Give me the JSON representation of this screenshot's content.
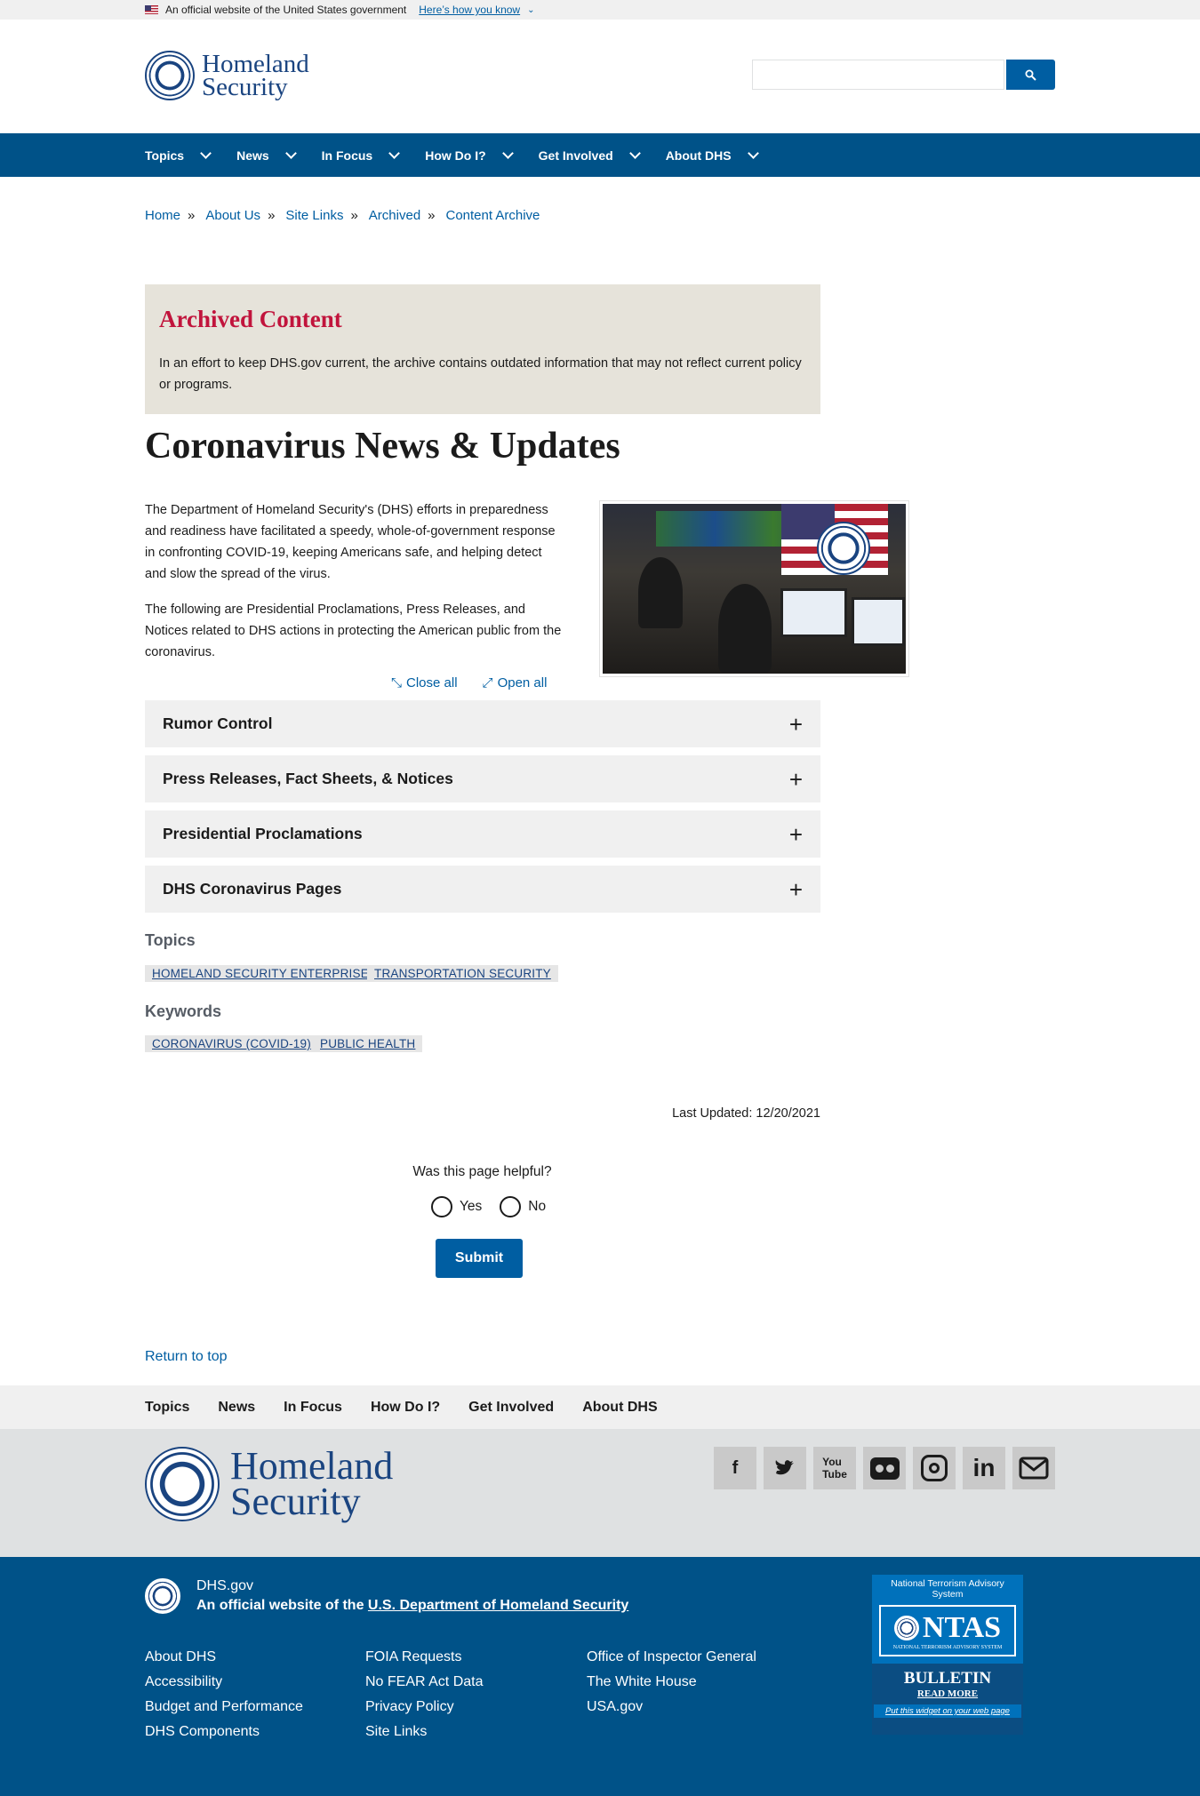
{
  "gov_banner": {
    "text": "An official website of the United States government",
    "link": "Here’s how you know"
  },
  "logo": {
    "line1": "Homeland",
    "line2": "Security"
  },
  "search": {
    "placeholder": ""
  },
  "nav": [
    "Topics",
    "News",
    "In Focus",
    "How Do I?",
    "Get Involved",
    "About DHS"
  ],
  "breadcrumb": [
    "Home",
    "About Us",
    "Site Links",
    "Archived",
    "Content Archive"
  ],
  "archived": {
    "title": "Archived Content",
    "text": "In an effort to keep DHS.gov current, the archive contains outdated information that may not reflect current policy or programs."
  },
  "page_title": "Coronavirus News & Updates",
  "intro": [
    "The Department of Homeland Security's (DHS) efforts in preparedness and readiness have facilitated a speedy, whole-of-government response in confronting COVID-19, keeping Americans safe, and helping detect and slow the spread of the virus.",
    "The following are Presidential Proclamations, Press Releases, and Notices related to DHS actions in protecting the American public from the coronavirus."
  ],
  "toggles": {
    "close": "Close all",
    "open": "Open all"
  },
  "accordions": [
    "Rumor Control",
    "Press Releases, Fact Sheets, & Notices",
    "Presidential Proclamations",
    "DHS Coronavirus Pages"
  ],
  "topics": {
    "label": "Topics",
    "tags": [
      "HOMELAND SECURITY ENTERPRISE",
      "TRANSPORTATION SECURITY"
    ]
  },
  "keywords": {
    "label": "Keywords",
    "tags": [
      "CORONAVIRUS (COVID-19)",
      "PUBLIC HEALTH"
    ]
  },
  "last_updated": "Last Updated: 12/20/2021",
  "feedback": {
    "question": "Was this page helpful?",
    "yes": "Yes",
    "no": "No",
    "submit": "Submit"
  },
  "return_top": "Return to top",
  "footer_nav": [
    "Topics",
    "News",
    "In Focus",
    "How Do I?",
    "Get Involved",
    "About DHS"
  ],
  "footer": {
    "site": "DHS.gov",
    "official_prefix": "An official website of the",
    "official_link": "U.S. Department of Homeland Security",
    "col1": [
      "About DHS",
      "Accessibility",
      "Budget and Performance",
      "DHS Components"
    ],
    "col2": [
      "FOIA Requests",
      "No FEAR Act Data",
      "Privacy Policy",
      "Site Links"
    ],
    "col3": [
      "Office of Inspector General",
      "The White House",
      "USA.gov"
    ],
    "ntas": {
      "top": "National Terrorism Advisory System",
      "logo": "NTAS",
      "sub": "NATIONAL TERRORISM ADVISORY SYSTEM",
      "bulletin": "BULLETIN",
      "read_more": "READ MORE",
      "widget": "Put this widget on your web page"
    }
  },
  "social": [
    "facebook-icon",
    "twitter-icon",
    "youtube-icon",
    "flickr-icon",
    "instagram-icon",
    "linkedin-icon",
    "email-icon"
  ]
}
